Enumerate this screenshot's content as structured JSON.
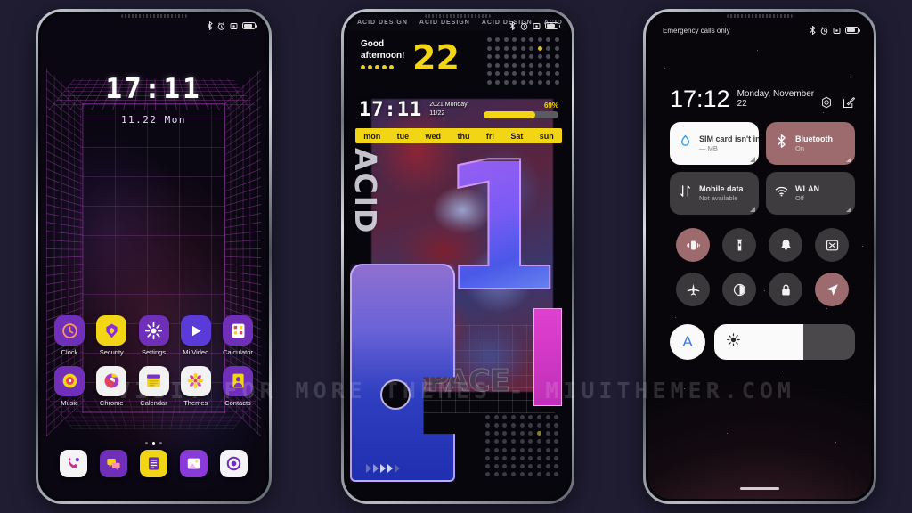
{
  "background_color": "#201d33",
  "watermark": "VISIT FOR MORE THEMES - MIUITHEMER.COM",
  "phone1": {
    "name": "home-screen",
    "statusbar": {
      "bluetooth": "bluetooth-icon",
      "alarm": "alarm-icon",
      "vibrate": "vibrate-icon",
      "battery": "battery-icon"
    },
    "clock": "17:11",
    "date": "11.22  Mon",
    "apps_row1": [
      {
        "label": "Clock",
        "icon": "clock-icon",
        "bg": "#6f2fb8",
        "fg": "#ff9b5a"
      },
      {
        "label": "Security",
        "icon": "shield-icon",
        "bg": "#f2d615",
        "fg": "#8a2be2"
      },
      {
        "label": "Settings",
        "icon": "gear-icon",
        "bg": "#6f2fb8",
        "fg": "#ffffff"
      },
      {
        "label": "Mi Video",
        "icon": "play-icon",
        "bg": "#5a3ad8",
        "fg": "#ffffff"
      },
      {
        "label": "Calculator",
        "icon": "calculator-icon",
        "bg": "#6f2fb8",
        "fg": "#ffffff"
      }
    ],
    "apps_row2": [
      {
        "label": "Music",
        "icon": "music-disc-icon",
        "bg": "#6f2fb8",
        "fg": "#f2d615"
      },
      {
        "label": "Chrome",
        "icon": "chrome-icon",
        "bg": "#f2f2f2",
        "fg": "#7a2fd0"
      },
      {
        "label": "Calendar",
        "icon": "calendar-icon",
        "bg": "#f2f2f2",
        "fg": "#f2d615"
      },
      {
        "label": "Themes",
        "icon": "themes-flower-icon",
        "bg": "#f2f2f2",
        "fg": "#f2d615"
      },
      {
        "label": "Contacts",
        "icon": "contacts-person-icon",
        "bg": "#6f2fb8",
        "fg": "#f2d615"
      }
    ],
    "page_dots": 3,
    "page_dot_active": 1,
    "dock": [
      {
        "label": "Phone",
        "icon": "phone-handset-icon",
        "bg": "#f4f4f6",
        "fg": "#d02e86"
      },
      {
        "label": "Messages",
        "icon": "message-bubble-icon",
        "bg": "#6f2fb8",
        "fg": "#f2d615"
      },
      {
        "label": "Notes",
        "icon": "notes-icon",
        "bg": "#f2d615",
        "fg": "#6f2fb8"
      },
      {
        "label": "Gallery",
        "icon": "gallery-image-icon",
        "bg": "#8a3ad8",
        "fg": "#ffffff"
      },
      {
        "label": "Browser",
        "icon": "target-ring-icon",
        "bg": "#f4f4f6",
        "fg": "#6f2fb8"
      }
    ]
  },
  "phone2": {
    "name": "themed-lock-screen",
    "header_repeat": [
      "ACID DESIGN",
      "ACID DESIGN",
      "ACID DESIGN",
      "ACID DESIGN"
    ],
    "greeting_line1": "Good",
    "greeting_line2": "afternoon!",
    "temperature": "22",
    "time": "17:11",
    "date_line1": "2021 Monday",
    "date_line2": "11/22",
    "battery_percent": "69%",
    "battery_value": 69,
    "days": [
      "mon",
      "tue",
      "wed",
      "thu",
      "fri",
      "Sat",
      "sun"
    ],
    "side_text": "ACID",
    "big_number": "1",
    "bottom_text": "SPACE",
    "accent_yellow": "#f2d615",
    "accent_purple": "#7b5cf5",
    "accent_magenta": "#e040d0"
  },
  "phone3": {
    "name": "control-center",
    "carrier": "Emergency calls only",
    "time": "17:12",
    "date": "Monday, November 22",
    "action_icons": [
      "settings-gear-icon",
      "edit-pencil-icon"
    ],
    "tiles": [
      {
        "title": "SIM card isn't in",
        "sub": "— MB",
        "icon": "data-usage-drop-icon",
        "style": "light",
        "state": "off"
      },
      {
        "title": "Bluetooth",
        "sub": "On",
        "icon": "bluetooth-icon",
        "style": "accent",
        "state": "on"
      },
      {
        "title": "Mobile data",
        "sub": "Not available",
        "icon": "mobile-data-arrows-icon",
        "style": "dark",
        "state": "off"
      },
      {
        "title": "WLAN",
        "sub": "Off",
        "icon": "wifi-icon",
        "style": "dark",
        "state": "off"
      }
    ],
    "circle_toggles": [
      {
        "name": "vibrate-icon",
        "label": "Vibrate",
        "state": "on"
      },
      {
        "name": "flashlight-icon",
        "label": "Flashlight",
        "state": "off"
      },
      {
        "name": "bell-icon",
        "label": "Ringer",
        "state": "off"
      },
      {
        "name": "screenshot-icon",
        "label": "Screenshot",
        "state": "off"
      },
      {
        "name": "airplane-icon",
        "label": "Airplane mode",
        "state": "off"
      },
      {
        "name": "dark-mode-icon",
        "label": "Dark mode",
        "state": "off"
      },
      {
        "name": "lock-icon",
        "label": "Lock",
        "state": "off"
      },
      {
        "name": "location-icon",
        "label": "Location",
        "state": "on"
      }
    ],
    "brightness": {
      "auto_label": "A",
      "icon": "brightness-sun-icon",
      "value": 63
    },
    "accent_color": "#9d6a6e"
  }
}
